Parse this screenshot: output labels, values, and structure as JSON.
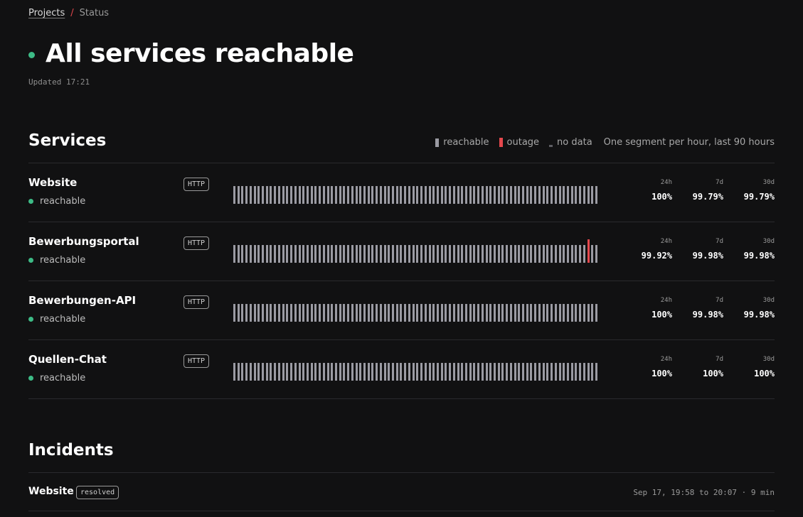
{
  "breadcrumb": {
    "parent": "Projects",
    "separator": "/",
    "current": "Status"
  },
  "hero": {
    "title": "All services reachable",
    "updated": "Updated 17:21",
    "status_color": "#3dbb86"
  },
  "services_section": {
    "title": "Services",
    "legend": {
      "reachable": "reachable",
      "outage": "outage",
      "no_data": "no data",
      "note": "One segment per hour, last 90 hours"
    }
  },
  "colors": {
    "reachable": "#9b9ba3",
    "outage": "#e5484d",
    "no_data": "#5d5d62",
    "accent_green": "#3dbb86"
  },
  "services": [
    {
      "name": "Website",
      "status": "reachable",
      "type": "HTTP",
      "segments": 90,
      "outages": [],
      "uptime": {
        "l24": "24h",
        "v24": "100%",
        "l7": "7d",
        "v7": "99.79%",
        "l30": "30d",
        "v30": "99.79%"
      }
    },
    {
      "name": "Bewerbungsportal",
      "status": "reachable",
      "type": "HTTP",
      "segments": 90,
      "outages": [
        87
      ],
      "uptime": {
        "l24": "24h",
        "v24": "99.92%",
        "l7": "7d",
        "v7": "99.98%",
        "l30": "30d",
        "v30": "99.98%"
      }
    },
    {
      "name": "Bewerbungen-API",
      "status": "reachable",
      "type": "HTTP",
      "segments": 90,
      "outages": [],
      "uptime": {
        "l24": "24h",
        "v24": "100%",
        "l7": "7d",
        "v7": "99.98%",
        "l30": "30d",
        "v30": "99.98%"
      }
    },
    {
      "name": "Quellen-Chat",
      "status": "reachable",
      "type": "HTTP",
      "segments": 90,
      "outages": [],
      "uptime": {
        "l24": "24h",
        "v24": "100%",
        "l7": "7d",
        "v7": "100%",
        "l30": "30d",
        "v30": "100%"
      }
    }
  ],
  "incidents_section": {
    "title": "Incidents"
  },
  "incidents": [
    {
      "service": "Website",
      "state": "resolved",
      "time": "Sep 17, 19:58 to 20:07 · 9 min"
    }
  ]
}
